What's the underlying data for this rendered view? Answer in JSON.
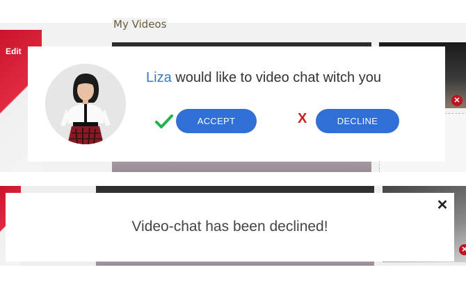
{
  "section": {
    "title": "My Videos"
  },
  "background": {
    "edit_label": "Edit"
  },
  "invite": {
    "caller_name": "Liza",
    "message_rest": "would like to video chat witch you",
    "accept_label": "ACCEPT",
    "decline_label": "DECLINE",
    "check_icon": "checkmark-icon",
    "decline_icon": "x-mark-icon",
    "colors": {
      "accent": "#2f6fd6",
      "name": "#3a78c7",
      "check": "#22b14c",
      "decline_x": "#cc1f1f"
    }
  },
  "toast": {
    "message": "Video-chat has been declined!",
    "close_glyph": "✕"
  },
  "remove_glyph": "✕"
}
